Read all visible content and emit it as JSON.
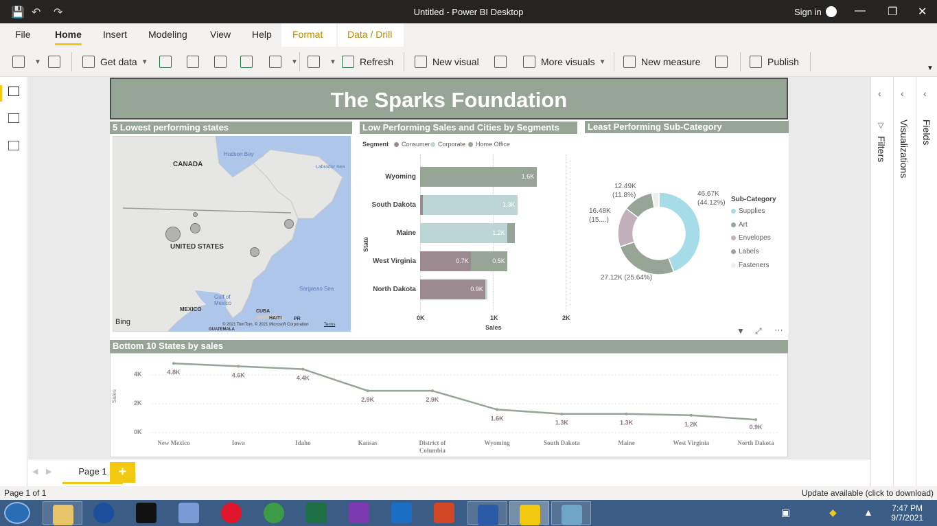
{
  "window": {
    "title": "Untitled - Power BI Desktop",
    "signin": "Sign in"
  },
  "ribbon_tabs": [
    "File",
    "Home",
    "Insert",
    "Modeling",
    "View",
    "Help",
    "Format",
    "Data / Drill"
  ],
  "toolbar": {
    "get_data": "Get data",
    "refresh": "Refresh",
    "new_visual": "New visual",
    "more_visuals": "More visuals",
    "new_measure": "New measure",
    "publish": "Publish"
  },
  "report": {
    "title": "The Sparks Foundation"
  },
  "map_visual": {
    "title": "5 Lowest performing states",
    "labels": {
      "canada": "CANADA",
      "us": "UNITED STATES",
      "mexico": "MEXICO",
      "hudson": "Hudson Bay",
      "labrador": "Labrador Sea",
      "sargasso": "Sargasso Sea",
      "gulf": "Gulf of Mexico",
      "cuba": "CUBA",
      "haiti": "HAITI",
      "pr": "PR",
      "guatemala": "GUATEMALA",
      "bing": "Bing",
      "copyright": "© 2021 TomTom, © 2021 Microsoft Corporation",
      "terms": "Terms"
    }
  },
  "bar_visual": {
    "title": "Low Performing Sales and Cities by Segments",
    "legend_title": "Segment",
    "legend": [
      "Consumer",
      "Corporate",
      "Home Office"
    ],
    "y_axis_label": "State",
    "x_axis_label": "Sales",
    "x_ticks": [
      "0K",
      "1K",
      "2K"
    ]
  },
  "donut_visual": {
    "title": "Least Performing Sub-Category",
    "legend_title": "Sub-Category",
    "legend": [
      "Supplies",
      "Art",
      "Envelopes",
      "Labels",
      "Fasteners"
    ],
    "slice_labels": [
      "46.67K",
      "(44.12%)",
      "27.12K (25.64%)",
      "16.48K",
      "(15....)",
      "12.49K",
      "(11.8%)"
    ]
  },
  "line_visual": {
    "title": "Bottom 10 States by sales",
    "y_axis_label": "Sales",
    "y_ticks": [
      "4K",
      "2K",
      "0K"
    ]
  },
  "panes": {
    "filters": "Filters",
    "visualizations": "Visualizations",
    "fields": "Fields"
  },
  "page_tab": "Page 1",
  "status": {
    "page": "Page 1 of 1",
    "update": "Update available (click to download)"
  },
  "clock": {
    "time": "7:47 PM",
    "date": "9/7/2021"
  },
  "colors": {
    "consumer": "#9b8b90",
    "corporate": "#bcd6d5",
    "home_office": "#97a597",
    "supplies": "#a6dbe8",
    "art": "#97a597",
    "envelopes": "#bfb0ba",
    "labels": "#97a597",
    "fasteners": "#efefef"
  },
  "chart_data": [
    {
      "type": "bar",
      "title": "Low Performing Sales and Cities by Segments",
      "categories": [
        "Wyoming",
        "South Dakota",
        "Maine",
        "West Virginia",
        "North Dakota"
      ],
      "series": [
        {
          "name": "Consumer",
          "values": [
            0,
            0.04,
            0,
            0.7,
            0.9
          ]
        },
        {
          "name": "Corporate",
          "values": [
            0,
            1.3,
            1.2,
            0,
            0.02
          ]
        },
        {
          "name": "Home Office",
          "values": [
            1.6,
            0,
            0.1,
            0.5,
            0
          ]
        }
      ],
      "value_labels": [
        [
          "",
          "",
          "1.6K"
        ],
        [
          "",
          "1.3K",
          ""
        ],
        [
          "",
          "1.2K",
          ""
        ],
        [
          "0.7K",
          "",
          "0.5K"
        ],
        [
          "0.9K",
          "",
          ""
        ]
      ],
      "xlabel": "Sales",
      "ylabel": "State",
      "xlim": [
        0,
        2
      ]
    },
    {
      "type": "pie",
      "title": "Least Performing Sub-Category",
      "categories": [
        "Supplies",
        "Art",
        "Envelopes",
        "Labels",
        "Fasteners"
      ],
      "values": [
        46.67,
        27.12,
        16.48,
        12.49,
        3.0
      ]
    },
    {
      "type": "line",
      "title": "Bottom 10 States by sales",
      "categories": [
        "New Mexico",
        "Iowa",
        "Idaho",
        "Kansas",
        "District of Columbia",
        "Wyoming",
        "South Dakota",
        "Maine",
        "West Virginia",
        "North Dakota"
      ],
      "values": [
        4.8,
        4.6,
        4.4,
        2.9,
        2.9,
        1.6,
        1.3,
        1.3,
        1.2,
        0.9
      ],
      "value_labels": [
        "4.8K",
        "4.6K",
        "4.4K",
        "2.9K",
        "2.9K",
        "1.6K",
        "1.3K",
        "1.3K",
        "1.2K",
        "0.9K"
      ],
      "ylabel": "Sales",
      "ylim": [
        0,
        5
      ]
    }
  ]
}
